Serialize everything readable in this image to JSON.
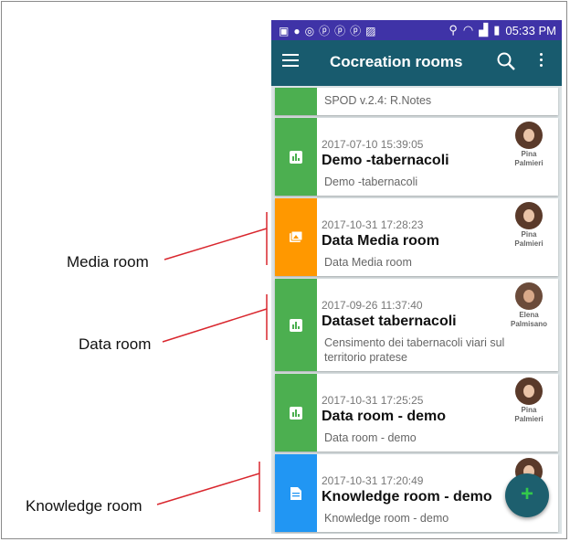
{
  "annotations": {
    "media_room": "Media room",
    "data_room": "Data room",
    "knowledge_room": "Knowledge room"
  },
  "status_bar": {
    "time": "05:33 PM",
    "color": "#3f33a7"
  },
  "app_bar": {
    "title": "Cocreation rooms",
    "color": "#185b6e"
  },
  "colors": {
    "data_room": "#4caf50",
    "media_room": "#ff9800",
    "knowledge_room": "#2196f3"
  },
  "rooms": [
    {
      "type": "data",
      "icon": "bar-chart-icon",
      "timestamp": "",
      "title": "",
      "description": "SPOD v.2.4: R.Notes",
      "author": ""
    },
    {
      "type": "data",
      "icon": "bar-chart-icon",
      "timestamp": "2017-07-10 15:39:05",
      "title": "Demo -tabernacoli",
      "description": "Demo -tabernacoli",
      "author": "Pina Palmieri"
    },
    {
      "type": "media",
      "icon": "image-icon",
      "timestamp": "2017-10-31 17:28:23",
      "title": "Data Media room",
      "description": "Data Media room",
      "author": "Pina Palmieri"
    },
    {
      "type": "data",
      "icon": "bar-chart-icon",
      "timestamp": "2017-09-26 11:37:40",
      "title": "Dataset tabernacoli",
      "description": "Censimento dei tabernacoli viari sul territorio pratese",
      "author": "Elena Palmisano"
    },
    {
      "type": "data",
      "icon": "bar-chart-icon",
      "timestamp": "2017-10-31 17:25:25",
      "title": "Data room - demo",
      "description": "Data room - demo",
      "author": "Pina Palmieri"
    },
    {
      "type": "knowledge",
      "icon": "document-icon",
      "timestamp": "2017-10-31 17:20:49",
      "title": "Knowledge room - demo",
      "description": "Knowledge room - demo",
      "author": ""
    }
  ],
  "fab": {
    "label": "+",
    "icon": "add-icon"
  }
}
